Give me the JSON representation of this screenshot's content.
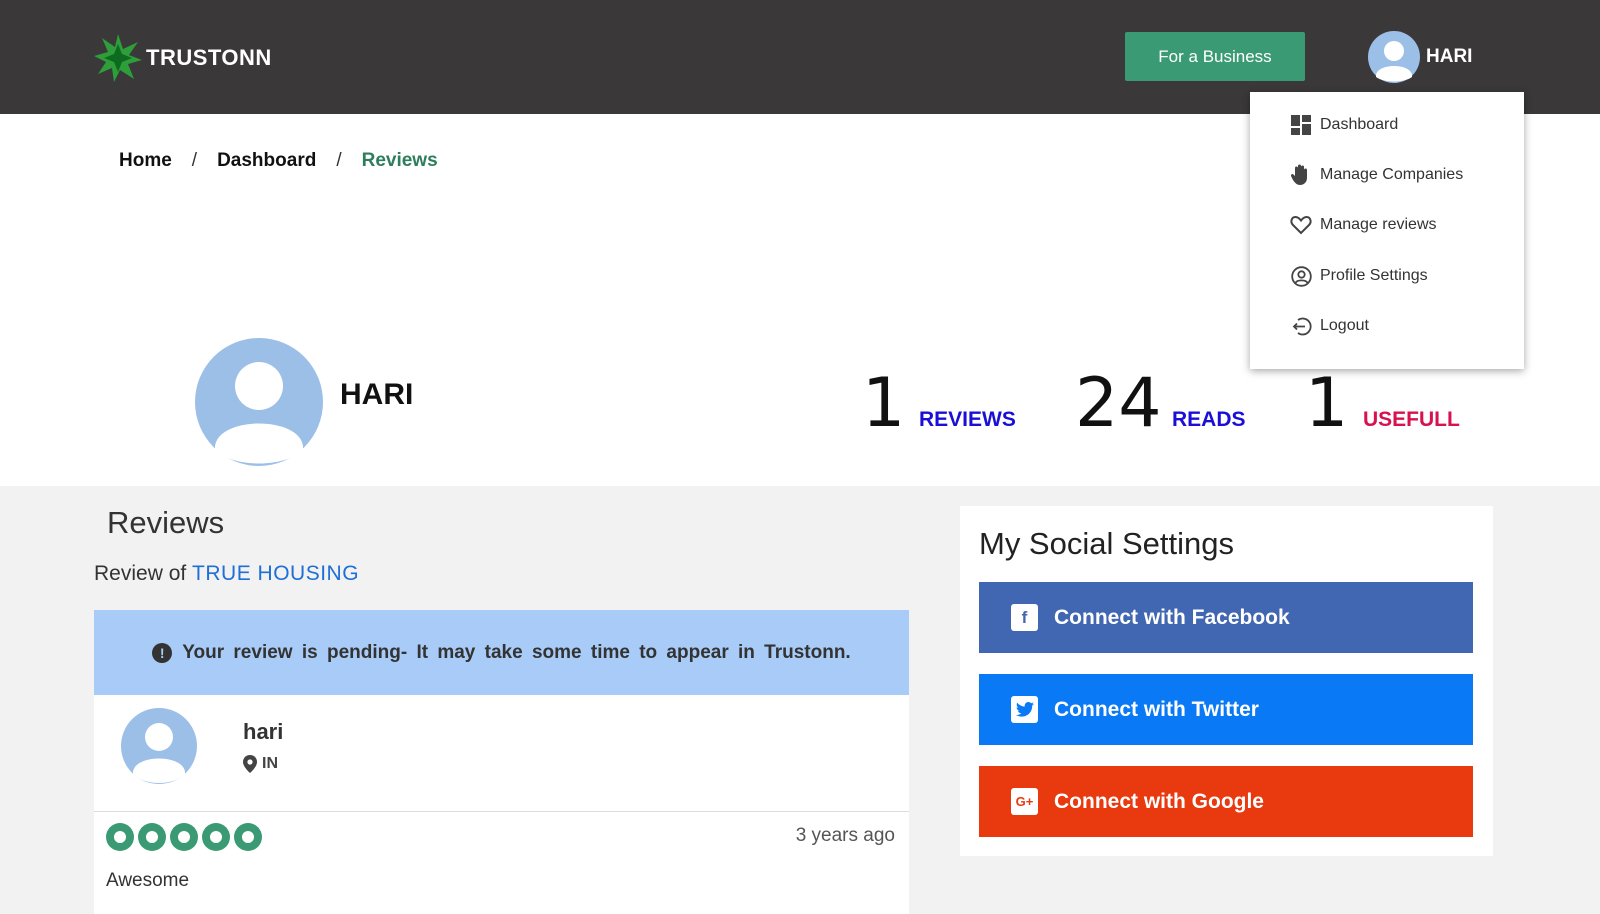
{
  "header": {
    "logo_text": "TRUSTONN",
    "business_button": "For a Business",
    "user_name": "HARI"
  },
  "dropdown": {
    "items": [
      {
        "label": "Dashboard",
        "icon": "dashboard-icon"
      },
      {
        "label": "Manage Companies",
        "icon": "hand-icon"
      },
      {
        "label": "Manage reviews",
        "icon": "heart-icon"
      },
      {
        "label": "Profile Settings",
        "icon": "user-circle-icon"
      },
      {
        "label": "Logout",
        "icon": "logout-icon"
      }
    ]
  },
  "breadcrumb": {
    "home": "Home",
    "dashboard": "Dashboard",
    "current": "Reviews",
    "separator": "/"
  },
  "profile": {
    "name": "HARI",
    "stats": [
      {
        "value": "1",
        "label": "REVIEWS",
        "color": "#1a0fd6"
      },
      {
        "value": "24",
        "label": "READS",
        "color": "#1a0fd6"
      },
      {
        "value": "1",
        "label": "USEFULL",
        "color": "#d6124f"
      }
    ]
  },
  "reviews": {
    "title": "Reviews",
    "review_of_prefix": "Review of",
    "company": "TRUE HOUSING",
    "pending_message": "Your review is pending- It may take some time to appear in Trustonn.",
    "reviewer_name": "hari",
    "reviewer_location": "IN",
    "rating": 5,
    "time": "3 years ago",
    "text": "Awesome"
  },
  "social": {
    "title": "My Social Settings",
    "buttons": [
      {
        "label": "Connect with Facebook",
        "color": "#4267b2",
        "icon": "facebook-icon"
      },
      {
        "label": "Connect with Twitter",
        "color": "#0a79f5",
        "icon": "twitter-icon"
      },
      {
        "label": "Connect with Google",
        "color": "#e8390f",
        "icon": "google-plus-icon"
      }
    ]
  },
  "colors": {
    "topbar": "#3a3839",
    "brand_green": "#3a9a74",
    "pending_bg": "#a9cbf7"
  }
}
